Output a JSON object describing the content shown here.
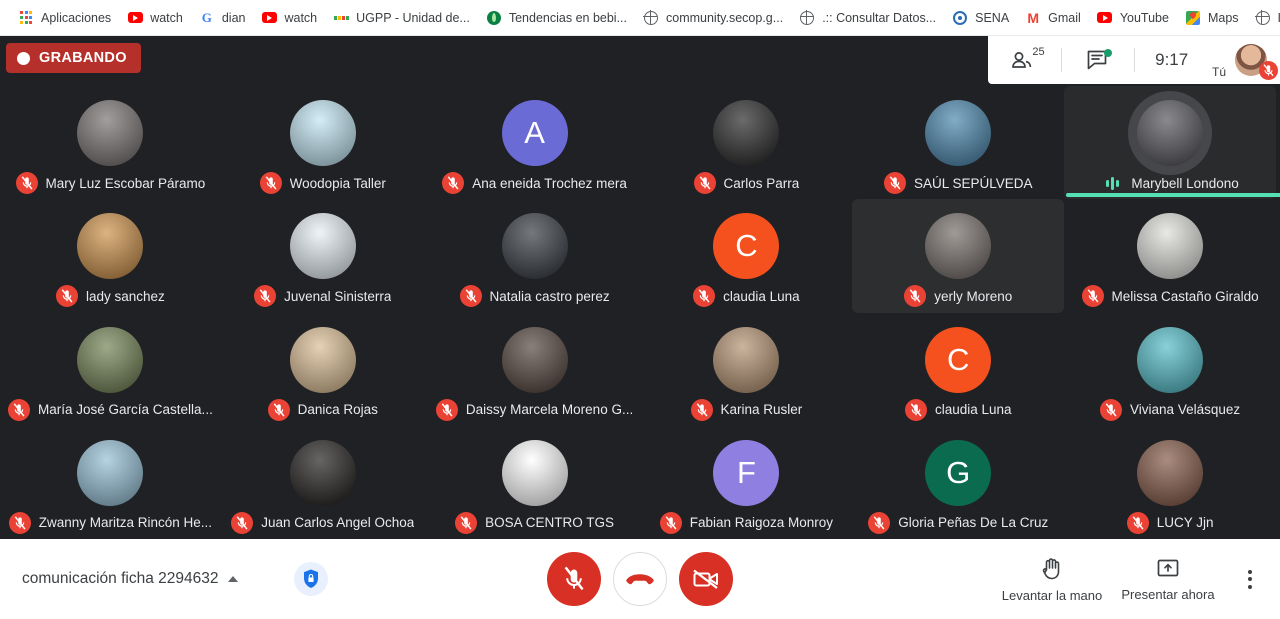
{
  "browser": {
    "bookmarks": [
      {
        "label": "Aplicaciones",
        "icon": "apps-grid-icon"
      },
      {
        "label": "watch",
        "icon": "youtube-icon"
      },
      {
        "label": "dian",
        "icon": "google-icon"
      },
      {
        "label": "watch",
        "icon": "youtube-icon"
      },
      {
        "label": "UGPP - Unidad de...",
        "icon": "ugpp-icon"
      },
      {
        "label": "Tendencias en bebi...",
        "icon": "leaf-icon"
      },
      {
        "label": "community.secop.g...",
        "icon": "globe-icon"
      },
      {
        "label": ".:: Consultar Datos...",
        "icon": "globe-icon"
      },
      {
        "label": "SENA",
        "icon": "sena-icon"
      },
      {
        "label": "Gmail",
        "icon": "gmail-icon"
      },
      {
        "label": "YouTube",
        "icon": "youtube-icon"
      },
      {
        "label": "Maps",
        "icon": "maps-icon"
      },
      {
        "label": "Inicio",
        "icon": "globe-icon"
      }
    ],
    "overflow_label": "»"
  },
  "topbar": {
    "recording_label": "GRABANDO",
    "participants_count": "25",
    "time": "9:17",
    "self_label": "Tú"
  },
  "participants": [
    {
      "name": "Mary Luz Escobar Páramo",
      "muted": true,
      "speaking": false,
      "hovered": false,
      "avatar_type": "photo",
      "avatar_color": "#6f6a68"
    },
    {
      "name": "Woodopia Taller",
      "muted": true,
      "speaking": false,
      "hovered": false,
      "avatar_type": "photo",
      "avatar_color": "#bde3f2"
    },
    {
      "name": "Ana eneida Trochez mera",
      "muted": true,
      "speaking": false,
      "hovered": false,
      "avatar_type": "initial",
      "initial": "A",
      "avatar_color": "#6b6bd6"
    },
    {
      "name": "Carlos Parra",
      "muted": true,
      "speaking": false,
      "hovered": false,
      "avatar_type": "photo",
      "avatar_color": "#1b1b1b"
    },
    {
      "name": "SAÚL SEPÚLVEDA",
      "muted": true,
      "speaking": false,
      "hovered": false,
      "avatar_type": "photo",
      "avatar_color": "#3f7fa8"
    },
    {
      "name": "Marybell Londono",
      "muted": false,
      "speaking": true,
      "hovered": false,
      "avatar_type": "photo",
      "avatar_color": "#4a4a52"
    },
    {
      "name": "lady sanchez",
      "muted": true,
      "speaking": false,
      "hovered": false,
      "avatar_type": "photo",
      "avatar_color": "#c98a3f"
    },
    {
      "name": "Juvenal Sinisterra",
      "muted": true,
      "speaking": false,
      "hovered": false,
      "avatar_type": "photo",
      "avatar_color": "#e6eef5"
    },
    {
      "name": "Natalia castro perez",
      "muted": true,
      "speaking": false,
      "hovered": false,
      "avatar_type": "photo",
      "avatar_color": "#2a2f36"
    },
    {
      "name": "claudia Luna",
      "muted": true,
      "speaking": false,
      "hovered": false,
      "avatar_type": "initial",
      "initial": "C",
      "avatar_color": "#f4511e"
    },
    {
      "name": "yerly Moreno",
      "muted": true,
      "speaking": false,
      "hovered": true,
      "avatar_type": "photo",
      "avatar_color": "#6d6560"
    },
    {
      "name": "Melissa Castaño Giraldo",
      "muted": true,
      "speaking": false,
      "hovered": false,
      "avatar_type": "photo",
      "avatar_color": "#dcdcd8"
    },
    {
      "name": "María José García Castella...",
      "muted": true,
      "speaking": false,
      "hovered": false,
      "avatar_type": "photo",
      "avatar_color": "#6a7a4a"
    },
    {
      "name": "Danica Rojas",
      "muted": true,
      "speaking": false,
      "hovered": false,
      "avatar_type": "photo",
      "avatar_color": "#d8b98e"
    },
    {
      "name": "Daissy Marcela Moreno G...",
      "muted": true,
      "speaking": false,
      "hovered": false,
      "avatar_type": "photo",
      "avatar_color": "#4a3a32"
    },
    {
      "name": "Karina Rusler",
      "muted": true,
      "speaking": false,
      "hovered": false,
      "avatar_type": "photo",
      "avatar_color": "#b08c6a"
    },
    {
      "name": "claudia Luna",
      "muted": true,
      "speaking": false,
      "hovered": false,
      "avatar_type": "initial",
      "initial": "C",
      "avatar_color": "#f4511e"
    },
    {
      "name": "Viviana Velásquez",
      "muted": true,
      "speaking": false,
      "hovered": false,
      "avatar_type": "photo",
      "avatar_color": "#49b8c4"
    },
    {
      "name": "Zwanny Maritza Rincón He...",
      "muted": true,
      "speaking": false,
      "hovered": false,
      "avatar_type": "photo",
      "avatar_color": "#8fbcd4"
    },
    {
      "name": "Juan Carlos Angel Ochoa",
      "muted": true,
      "speaking": false,
      "hovered": false,
      "avatar_type": "photo",
      "avatar_color": "#151311"
    },
    {
      "name": "BOSA CENTRO TGS",
      "muted": true,
      "speaking": false,
      "hovered": false,
      "avatar_type": "photo",
      "avatar_color": "#ffffff"
    },
    {
      "name": "Fabian Raigoza Monroy",
      "muted": true,
      "speaking": false,
      "hovered": false,
      "avatar_type": "initial",
      "initial": "F",
      "avatar_color": "#8f7fe0"
    },
    {
      "name": "Gloria Peñas De La Cruz",
      "muted": true,
      "speaking": false,
      "hovered": false,
      "avatar_type": "initial",
      "initial": "G",
      "avatar_color": "#0b6b4f"
    },
    {
      "name": "LUCY Jjn",
      "muted": true,
      "speaking": false,
      "hovered": false,
      "avatar_type": "photo",
      "avatar_color": "#7d4f3c"
    }
  ],
  "bottombar": {
    "meeting_code": "comunicación ficha 2294632",
    "raise_hand_label": "Levantar la mano",
    "present_now_label": "Presentar ahora"
  },
  "colors": {
    "recording_red": "#b52f2b",
    "control_red": "#d93025",
    "mic_off_red": "#ea4335",
    "speaking_green": "#56dfb2",
    "app_background": "#202124",
    "bar_background": "#ffffff"
  }
}
